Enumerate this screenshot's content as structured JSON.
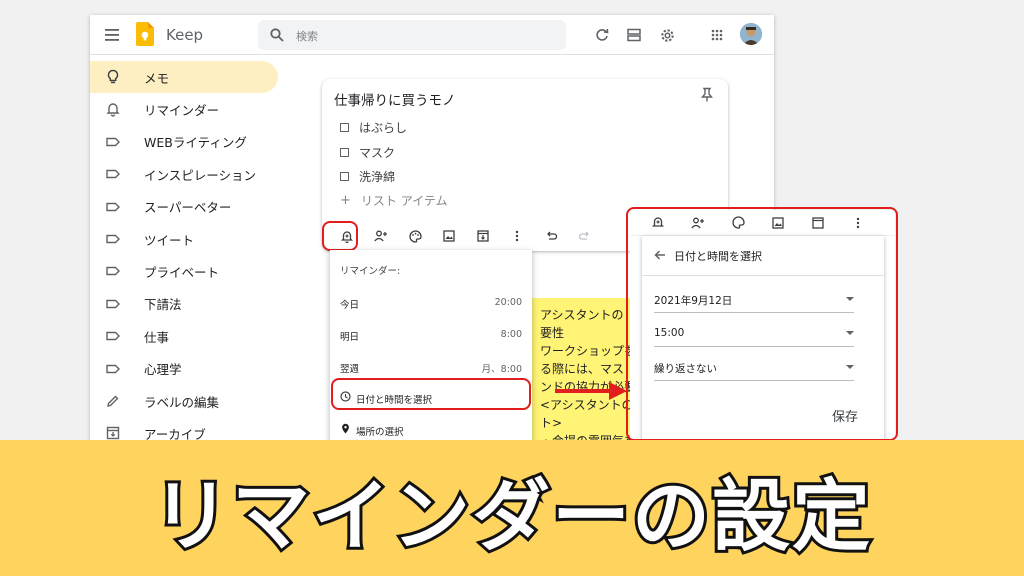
{
  "app": {
    "name": "Keep"
  },
  "search": {
    "placeholder": "検索"
  },
  "sidebar": {
    "items": [
      {
        "label": "メモ",
        "icon": "lightbulb-icon"
      },
      {
        "label": "リマインダー",
        "icon": "bell-icon"
      },
      {
        "label": "WEBライティング",
        "icon": "label-icon"
      },
      {
        "label": "インスピレーション",
        "icon": "label-icon"
      },
      {
        "label": "スーパーベター",
        "icon": "label-icon"
      },
      {
        "label": "ツイート",
        "icon": "label-icon"
      },
      {
        "label": "プライベート",
        "icon": "label-icon"
      },
      {
        "label": "下請法",
        "icon": "label-icon"
      },
      {
        "label": "仕事",
        "icon": "label-icon"
      },
      {
        "label": "心理学",
        "icon": "label-icon"
      },
      {
        "label": "ラベルの編集",
        "icon": "pencil-icon"
      },
      {
        "label": "アーカイブ",
        "icon": "archive-icon"
      }
    ]
  },
  "note": {
    "title": "仕事帰りに買うモノ",
    "items": [
      "はぶらし",
      "マスク",
      "洗浄綿"
    ],
    "add_item": "リスト アイテム"
  },
  "yellow_note": {
    "text": "アシスタントの\n要性\nワークショップを\nる際には、マス\nンドの協力が必要\n<アシスタントの\nト>\n・会場の雰囲気を"
  },
  "reminder_menu": {
    "header": "リマインダー:",
    "options": [
      {
        "label": "今日",
        "time": "20:00"
      },
      {
        "label": "明日",
        "time": "8:00"
      },
      {
        "label": "翌週",
        "time": "月、8:00"
      }
    ],
    "pick_datetime": "日付と時間を選択",
    "pick_place": "場所の選択"
  },
  "datetime_panel": {
    "title": "日付と時間を選択",
    "date": "2021年9月12日",
    "time": "15:00",
    "repeat": "繰り返さない",
    "save": "保存"
  },
  "caption": {
    "text": "リマインダーの設定"
  },
  "colors": {
    "accent_yellow": "#ffd45e",
    "highlight_red": "#e11d1d",
    "active_nav": "#feefc3",
    "note_yellow": "#fff475"
  }
}
